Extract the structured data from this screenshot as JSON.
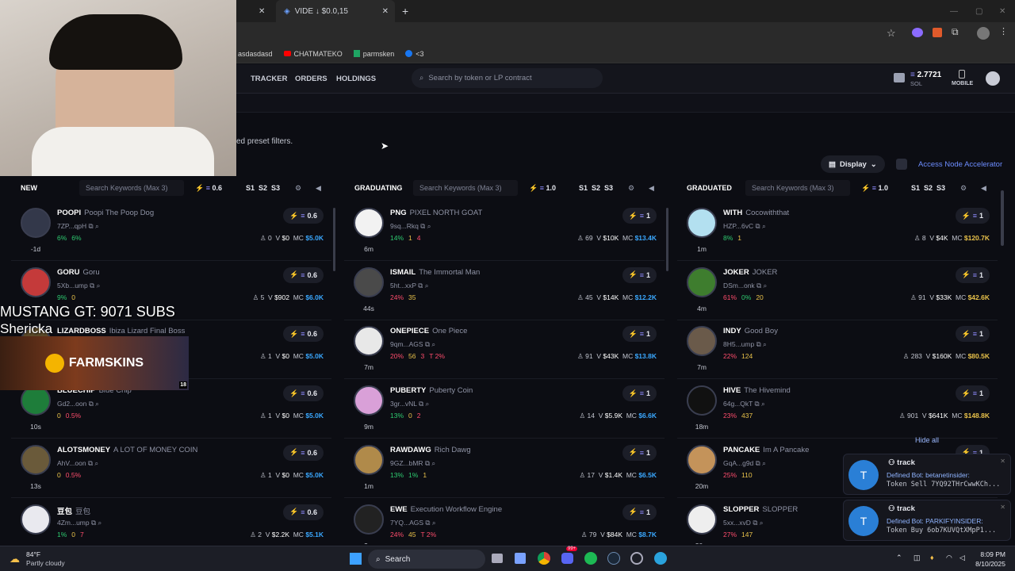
{
  "browser": {
    "tabs": [
      {
        "label": "VIDE ↓ $0.0,15"
      }
    ],
    "bookmarks": [
      "asdasdasd",
      "CHATMATEKO",
      "parmsken",
      "<3"
    ]
  },
  "nav": {
    "items": [
      "TRACKER",
      "ORDERS",
      "HOLDINGS"
    ],
    "search_placeholder": "Search by token or LP contract",
    "balance": "2.7721",
    "currency": "SOL",
    "mobile": "MOBILE"
  },
  "preset_note": "ed preset filters.",
  "toolbar": {
    "display": "Display",
    "accelerator": "Access Node Accelerator"
  },
  "overlay": {
    "stream_title": "MUSTANG GT: 9071 SUBS",
    "stream_user": "Shericka",
    "promo": "FARMSKINS",
    "promo_age": "18"
  },
  "columns": [
    {
      "title": "NEW",
      "kw": "Search Keywords (Max 3)",
      "amount": "0.6",
      "presets": [
        "S1",
        "S2",
        "S3"
      ],
      "cards": [
        {
          "sym": "POOPI",
          "name": "Poopi The Poop Dog",
          "addr": "7ZP...qpH",
          "stats": [
            {
              "v": "6%",
              "c": "g"
            },
            {
              "v": "6%",
              "c": "g"
            }
          ],
          "age": "-1d",
          "buy": "0.6",
          "holders": "0",
          "vol": "$0",
          "mc": "$5.0K"
        },
        {
          "sym": "GORU",
          "name": "Goru",
          "addr": "5Xb...ump",
          "stats": [
            {
              "v": "9%",
              "c": "g"
            },
            {
              "v": "0",
              "c": "y"
            }
          ],
          "age": "",
          "buy": "0.6",
          "holders": "5",
          "vol": "$902",
          "mc": "$6.0K"
        },
        {
          "sym": "LIZARDBOSS",
          "name": "Ibiza Lizard Final Boss",
          "addr": "",
          "stats": [],
          "age": "",
          "buy": "0.6",
          "holders": "1",
          "vol": "$0",
          "mc": "$5.0K"
        },
        {
          "sym": "BLUECHIP",
          "name": "Blue Chip",
          "addr": "Gd2...oon",
          "stats": [
            {
              "v": "0",
              "c": "y"
            },
            {
              "v": "0.5%",
              "c": "r"
            }
          ],
          "age": "10s",
          "buy": "0.6",
          "holders": "1",
          "vol": "$0",
          "mc": "$5.0K"
        },
        {
          "sym": "ALOTSMONEY",
          "name": "A LOT OF MONEY COIN",
          "addr": "AhV...oon",
          "stats": [
            {
              "v": "0",
              "c": "y"
            },
            {
              "v": "0.5%",
              "c": "r"
            }
          ],
          "age": "13s",
          "buy": "0.6",
          "holders": "1",
          "vol": "$0",
          "mc": "$5.0K"
        },
        {
          "sym": "豆包",
          "name": "豆包",
          "addr": "4Zm...ump",
          "stats": [
            {
              "v": "1%",
              "c": "g"
            },
            {
              "v": "0",
              "c": "y"
            },
            {
              "v": "7",
              "c": "r"
            }
          ],
          "age": "",
          "buy": "0.6",
          "holders": "2",
          "vol": "$2.2K",
          "mc": "$5.1K"
        }
      ]
    },
    {
      "title": "GRADUATING",
      "kw": "Search Keywords (Max 3)",
      "amount": "1.0",
      "presets": [
        "S1",
        "S2",
        "S3"
      ],
      "cards": [
        {
          "sym": "PNG",
          "name": "PIXEL NORTH GOAT",
          "addr": "9sq...Rkq",
          "stats": [
            {
              "v": "14%",
              "c": "g"
            },
            {
              "v": "1",
              "c": "y"
            },
            {
              "v": "4",
              "c": "r"
            }
          ],
          "age": "6m",
          "buy": "1",
          "holders": "69",
          "vol": "$10K",
          "mc": "$13.4K"
        },
        {
          "sym": "ISMAIL",
          "name": "The Immortal Man",
          "addr": "5ht...xxP",
          "stats": [
            {
              "v": "24%",
              "c": "r"
            },
            {
              "v": "35",
              "c": "y"
            }
          ],
          "age": "44s",
          "buy": "1",
          "holders": "45",
          "vol": "$14K",
          "mc": "$12.2K"
        },
        {
          "sym": "ONEPIECE",
          "name": "One Piece",
          "addr": "9qm...AGS",
          "stats": [
            {
              "v": "20%",
              "c": "r"
            },
            {
              "v": "56",
              "c": "y"
            },
            {
              "v": "3",
              "c": "r"
            },
            {
              "v": "T 2%",
              "c": "r"
            }
          ],
          "age": "7m",
          "buy": "1",
          "holders": "91",
          "vol": "$43K",
          "mc": "$13.8K"
        },
        {
          "sym": "PUBERTY",
          "name": "Puberty Coin",
          "addr": "3gr...vNL",
          "stats": [
            {
              "v": "13%",
              "c": "g"
            },
            {
              "v": "0",
              "c": "y"
            },
            {
              "v": "2",
              "c": "r"
            }
          ],
          "age": "9m",
          "buy": "1",
          "holders": "14",
          "vol": "$5.9K",
          "mc": "$6.6K"
        },
        {
          "sym": "RAWDAWG",
          "name": "Rich Dawg",
          "addr": "9GZ...bMR",
          "stats": [
            {
              "v": "13%",
              "c": "g"
            },
            {
              "v": "1%",
              "c": "g"
            },
            {
              "v": "1",
              "c": "y"
            }
          ],
          "age": "1m",
          "buy": "1",
          "holders": "17",
          "vol": "$1.4K",
          "mc": "$6.5K"
        },
        {
          "sym": "EWE",
          "name": "Execution Workflow Engine",
          "addr": "7YQ...AGS",
          "stats": [
            {
              "v": "24%",
              "c": "r"
            },
            {
              "v": "45",
              "c": "y"
            },
            {
              "v": "T 2%",
              "c": "r"
            }
          ],
          "age": "3m",
          "buy": "1",
          "holders": "79",
          "vol": "$84K",
          "mc": "$8.7K"
        }
      ]
    },
    {
      "title": "GRADUATED",
      "kw": "Search Keywords (Max 3)",
      "amount": "1.0",
      "presets": [
        "S1",
        "S2",
        "S3"
      ],
      "cards": [
        {
          "sym": "WITH",
          "name": "Cocowiththat",
          "addr": "HZP...6vC",
          "stats": [
            {
              "v": "8%",
              "c": "g"
            },
            {
              "v": "1",
              "c": "y"
            }
          ],
          "age": "1m",
          "buy": "1",
          "holders": "8",
          "vol": "$4K",
          "mc": "$120.7K"
        },
        {
          "sym": "JOKER",
          "name": "JOKER",
          "addr": "DSm...onk",
          "stats": [
            {
              "v": "61%",
              "c": "r"
            },
            {
              "v": "0%",
              "c": "g"
            },
            {
              "v": "20",
              "c": "y"
            }
          ],
          "age": "4m",
          "buy": "1",
          "holders": "91",
          "vol": "$33K",
          "mc": "$42.6K"
        },
        {
          "sym": "INDY",
          "name": "Good Boy",
          "addr": "8H5...ump",
          "stats": [
            {
              "v": "22%",
              "c": "r"
            },
            {
              "v": "124",
              "c": "y"
            }
          ],
          "age": "7m",
          "buy": "1",
          "holders": "283",
          "vol": "$160K",
          "mc": "$80.5K"
        },
        {
          "sym": "HIVE",
          "name": "The Hivemind",
          "addr": "64g...QkT",
          "stats": [
            {
              "v": "23%",
              "c": "r"
            },
            {
              "v": "437",
              "c": "y"
            }
          ],
          "age": "18m",
          "buy": "1",
          "holders": "901",
          "vol": "$641K",
          "mc": "$148.8K"
        },
        {
          "sym": "PANCAKE",
          "name": "Im A Pancake",
          "addr": "GqA...g9d",
          "stats": [
            {
              "v": "25%",
              "c": "r"
            },
            {
              "v": "110",
              "c": "y"
            }
          ],
          "age": "20m",
          "buy": "1",
          "holders": "",
          "vol": "",
          "mc": ""
        },
        {
          "sym": "SLOPPER",
          "name": "SLOPPER",
          "addr": "5xx...xvD",
          "stats": [
            {
              "v": "27%",
              "c": "r"
            },
            {
              "v": "147",
              "c": "y"
            }
          ],
          "age": "30m",
          "buy": "",
          "holders": "",
          "vol": "",
          "mc": ""
        }
      ]
    }
  ],
  "notifications": {
    "hide_all": "Hide all",
    "items": [
      {
        "title": "track",
        "line1": "Defined Bot: betanetinsider:",
        "line2": "Token Sell 7YQ92THrCwwKCh..."
      },
      {
        "title": "track",
        "line1": "Defined Bot: PARKIFYINSIDER:",
        "line2": "Token Buy 6ob7KUVQtXMpP1..."
      }
    ]
  },
  "taskbar": {
    "weather_temp": "84°F",
    "weather_desc": "Partly cloudy",
    "search": "Search",
    "time": "8:09 PM",
    "date": "8/10/2025",
    "badge": "99+"
  }
}
